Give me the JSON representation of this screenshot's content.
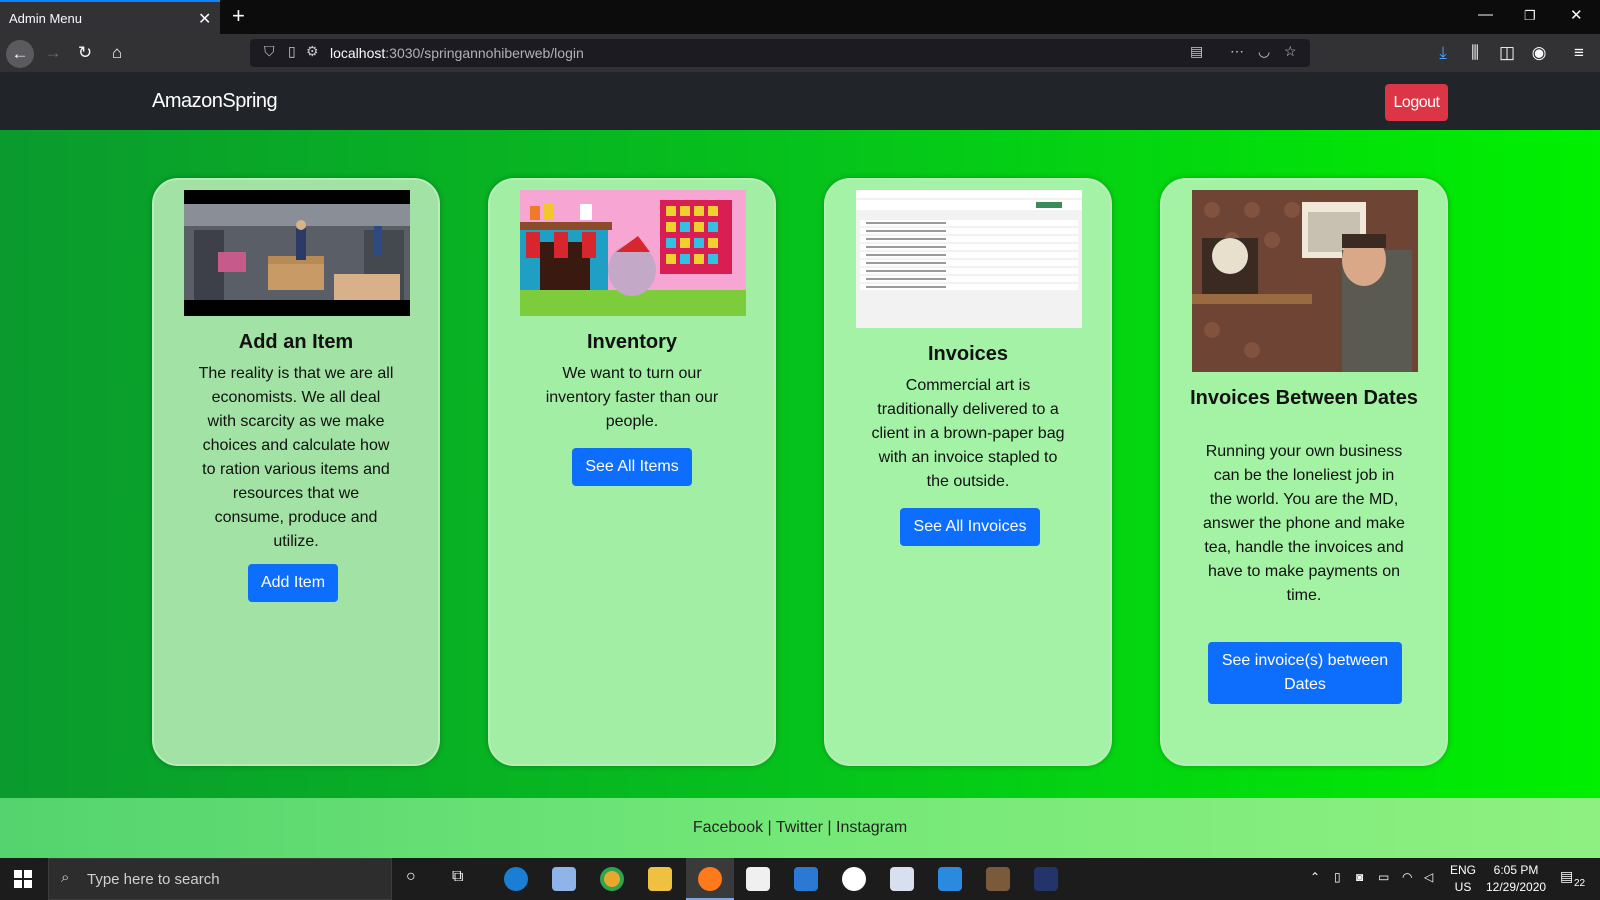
{
  "browser": {
    "tab_title": "Admin Menu",
    "url_host": "localhost",
    "url_path": ":3030/springannohiberweb/login"
  },
  "site": {
    "brand": "AmazonSpring",
    "logout_label": "Logout"
  },
  "cards": [
    {
      "title": "Add an Item",
      "text": "The reality is that we are all economists. We all deal with scarcity as we make choices and calculate how to ration various items and resources that we consume, produce and utilize.",
      "button": "Add Item"
    },
    {
      "title": "Inventory",
      "text": "We want to turn our inventory faster than our people.",
      "button": "See All Items"
    },
    {
      "title": "Invoices",
      "text": "Commercial art is traditionally delivered to a client in a brown-paper bag with an invoice stapled to the outside.",
      "button": "See All Invoices"
    },
    {
      "title": "Invoices Between Dates",
      "text": "Running your own business can be the loneliest job in the world. You are the MD, answer the phone and make tea, handle the invoices and have to make payments on time.",
      "button": "See invoice(s) between Dates"
    }
  ],
  "footer": {
    "facebook": "Facebook",
    "twitter": "Twitter",
    "instagram": "Instagram",
    "separator": " | "
  },
  "taskbar": {
    "search_placeholder": "Type here to search",
    "lang_top": "ENG",
    "lang_bottom": "US",
    "time": "6:05 PM",
    "date": "12/29/2020",
    "notifications": "22"
  },
  "colors": {
    "accent_tab": "#0a84ff",
    "logout": "#dc3545",
    "primary_button": "#0d6efd"
  }
}
